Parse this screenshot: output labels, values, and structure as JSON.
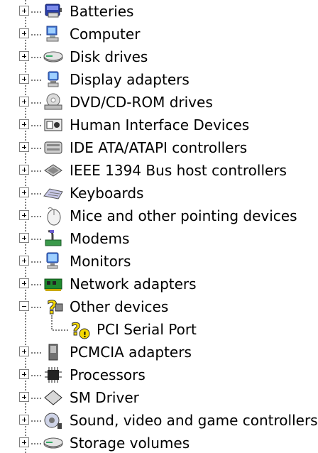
{
  "tree": {
    "items": [
      {
        "label": "Batteries",
        "icon": "battery-icon",
        "expanded": false
      },
      {
        "label": "Computer",
        "icon": "computer-icon",
        "expanded": false
      },
      {
        "label": "Disk drives",
        "icon": "disk-drive-icon",
        "expanded": false
      },
      {
        "label": "Display adapters",
        "icon": "display-adapter-icon",
        "expanded": false
      },
      {
        "label": "DVD/CD-ROM drives",
        "icon": "dvd-drive-icon",
        "expanded": false
      },
      {
        "label": "Human Interface Devices",
        "icon": "hid-icon",
        "expanded": false
      },
      {
        "label": "IDE ATA/ATAPI controllers",
        "icon": "ide-controller-icon",
        "expanded": false
      },
      {
        "label": "IEEE 1394 Bus host controllers",
        "icon": "ieee1394-icon",
        "expanded": false
      },
      {
        "label": "Keyboards",
        "icon": "keyboard-icon",
        "expanded": false
      },
      {
        "label": "Mice and other pointing devices",
        "icon": "mouse-icon",
        "expanded": false
      },
      {
        "label": "Modems",
        "icon": "modem-icon",
        "expanded": false
      },
      {
        "label": "Monitors",
        "icon": "monitor-icon",
        "expanded": false
      },
      {
        "label": "Network adapters",
        "icon": "network-adapter-icon",
        "expanded": false
      },
      {
        "label": "Other devices",
        "icon": "unknown-device-icon",
        "expanded": true,
        "children": [
          {
            "label": "PCI Serial Port",
            "icon": "unknown-device-warning-icon"
          }
        ]
      },
      {
        "label": "PCMCIA adapters",
        "icon": "pcmcia-icon",
        "expanded": false
      },
      {
        "label": "Processors",
        "icon": "processor-icon",
        "expanded": false
      },
      {
        "label": "SM Driver",
        "icon": "sm-driver-icon",
        "expanded": false
      },
      {
        "label": "Sound, video and game controllers",
        "icon": "sound-icon",
        "expanded": false
      },
      {
        "label": "Storage volumes",
        "icon": "storage-volume-icon",
        "expanded": false
      }
    ]
  },
  "colors": {
    "background": "#ffffff",
    "connector": "#808080",
    "expander_border": "#7f7f7f",
    "warning_yellow": "#f5d800"
  }
}
